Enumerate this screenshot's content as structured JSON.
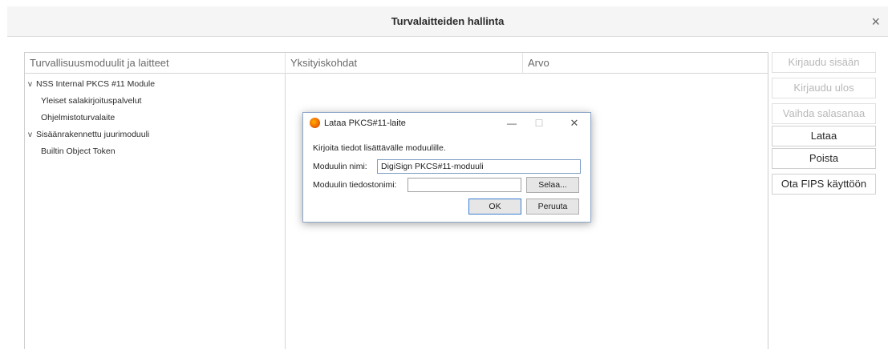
{
  "window": {
    "title": "Turvalaitteiden hallinta",
    "close_glyph": "×"
  },
  "table": {
    "headers": [
      "Turvallisuusmoduulit ja laitteet",
      "Yksityiskohdat",
      "Arvo"
    ],
    "tree": [
      {
        "label": "NSS Internal PKCS #11 Module",
        "expanded": true,
        "level": 0
      },
      {
        "label": "Yleiset salakirjoituspalvelut",
        "level": 1
      },
      {
        "label": "Ohjelmistoturvalaite",
        "level": 1
      },
      {
        "label": "Sisäänrakennettu juurimoduuli",
        "expanded": true,
        "level": 0
      },
      {
        "label": "Builtin Object Token",
        "level": 1
      }
    ]
  },
  "buttons": {
    "login": "Kirjaudu sisään",
    "logout": "Kirjaudu ulos",
    "change_password": "Vaihda salasanaa",
    "load": "Lataa",
    "remove": "Poista",
    "fips": "Ota FIPS käyttöön"
  },
  "dialog": {
    "title": "Lataa PKCS#11-laite",
    "message": "Kirjoita tiedot lisättävälle moduulille.",
    "module_name_label": "Moduulin nimi:",
    "module_name_value": "DigiSign PKCS#11-moduuli",
    "module_file_label": "Moduulin tiedostonimi:",
    "module_file_value": "",
    "browse": "Selaa...",
    "ok": "OK",
    "cancel": "Peruuta"
  },
  "colors": {
    "accent": "#3c7fd2",
    "disabled_text": "#b8b8b8"
  }
}
